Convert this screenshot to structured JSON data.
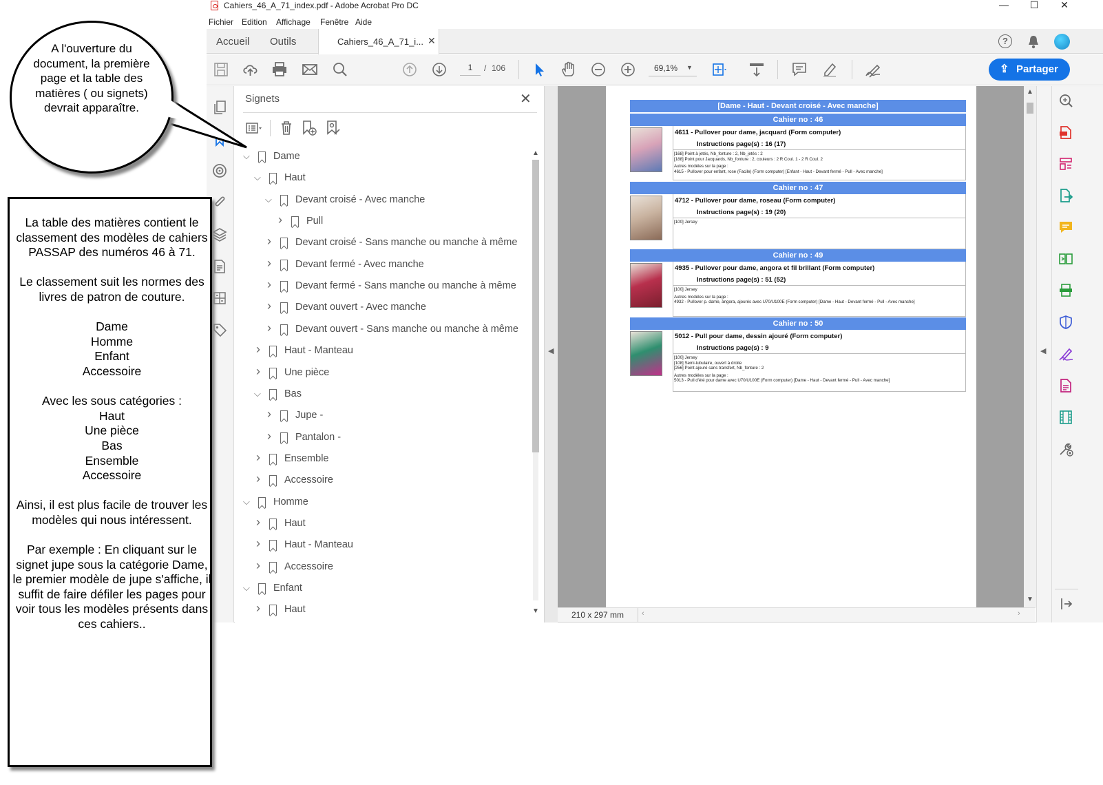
{
  "window": {
    "title": "Cahiers_46_A_71_index.pdf - Adobe Acrobat Pro DC",
    "controls": {
      "minimize": "—",
      "maximize": "☐",
      "close": "✕"
    }
  },
  "menu": [
    "Fichier",
    "Edition",
    "Affichage",
    "Fenêtre",
    "Aide"
  ],
  "tabs": {
    "home": "Accueil",
    "tools": "Outils",
    "document": "Cahiers_46_A_71_i...",
    "close": "✕"
  },
  "toolbar": {
    "page_current": "1",
    "page_sep": "/",
    "page_total": "106",
    "zoom": "69,1%",
    "share_label": "Partager"
  },
  "bookmarks": {
    "title": "Signets",
    "close": "✕",
    "items": [
      {
        "label": "Dame",
        "expanded": true,
        "level": 0
      },
      {
        "label": "Haut",
        "expanded": true,
        "level": 1
      },
      {
        "label": "Devant croisé - Avec manche",
        "expanded": true,
        "level": 2
      },
      {
        "label": "Pull",
        "expanded": false,
        "level": 3
      },
      {
        "label": "Devant croisé - Sans manche ou manche à même",
        "expanded": false,
        "level": 2
      },
      {
        "label": "Devant fermé - Avec manche",
        "expanded": false,
        "level": 2
      },
      {
        "label": "Devant fermé - Sans manche ou manche à même",
        "expanded": false,
        "level": 2
      },
      {
        "label": "Devant ouvert - Avec manche",
        "expanded": false,
        "level": 2
      },
      {
        "label": "Devant ouvert - Sans manche ou manche à même",
        "expanded": false,
        "level": 2
      },
      {
        "label": "Haut - Manteau",
        "expanded": false,
        "level": 1
      },
      {
        "label": "Une pièce",
        "expanded": false,
        "level": 1
      },
      {
        "label": "Bas",
        "expanded": true,
        "level": 1
      },
      {
        "label": "Jupe -",
        "expanded": false,
        "level": 2
      },
      {
        "label": "Pantalon -",
        "expanded": false,
        "level": 2
      },
      {
        "label": "Ensemble",
        "expanded": false,
        "level": 1
      },
      {
        "label": "Accessoire",
        "expanded": false,
        "level": 1
      },
      {
        "label": "Homme",
        "expanded": true,
        "level": 0
      },
      {
        "label": "Haut",
        "expanded": false,
        "level": 1
      },
      {
        "label": "Haut - Manteau",
        "expanded": false,
        "level": 1
      },
      {
        "label": "Accessoire",
        "expanded": false,
        "level": 1
      },
      {
        "label": "Enfant",
        "expanded": true,
        "level": 0
      },
      {
        "label": "Haut",
        "expanded": false,
        "level": 1
      }
    ]
  },
  "document": {
    "page_size": "210 x 297 mm",
    "header": "[Dame - Haut - Devant croisé - Avec manche]",
    "entries": [
      {
        "cahier": "Cahier no : 46",
        "model": "4611 - Pullover pour dame, jacquard   (Form computer)",
        "instructions": "Instructions page(s) : 16 (17)",
        "details": [
          "[168] Point à jetés, Nb_fonture : 2, Nb_jetés : 2",
          "[188] Point pour Jacquards, Nb_fonture : 2, couleurs : 2 R Coul. 1 -  2 R Coul. 2"
        ],
        "others": [
          "Autres modèles sur la page :",
          "4615 - Pullover pour enfant, rose (Facile)   (Form computer)  [Enfant - Haut - Devant fermé - Pull - Avec manche]"
        ]
      },
      {
        "cahier": "Cahier no : 47",
        "model": "4712 - Pullover pour dame, roseau   (Form computer)",
        "instructions": "Instructions page(s) : 19 (20)",
        "details": [
          "[100] Jersey"
        ],
        "others": []
      },
      {
        "cahier": "Cahier no : 49",
        "model": "4935 - Pullover pour dame, angora et fil brillant   (Form computer)",
        "instructions": "Instructions page(s) : 51 (52)",
        "details": [
          "[100] Jersey"
        ],
        "others": [
          "Autres modèles sur la page :",
          "4932 - Pullover p. dame, angora, ajourés avec U70/U100E   (Form computer)  [Dame - Haut - Devant fermé - Pull - Avec manche]"
        ]
      },
      {
        "cahier": "Cahier no : 50",
        "model": "5012 - Pull pour dame, dessin ajouré   (Form computer)",
        "instructions": "Instructions page(s) : 9",
        "details": [
          "[100] Jersey",
          "[108] Semi-tubulaire, ouvert à droite",
          "[256] Point ajouré sans transfert, Nb_fonture : 2"
        ],
        "others": [
          "Autres modèles sur la page :",
          "5013 - Pull d'été pour dame avec U70/U100E   (Form computer)  [Dame - Haut - Devant fermé - Pull - Avec manche]"
        ]
      }
    ]
  },
  "annotations": {
    "bubble": "A l'ouverture du document, la première page et la table des matières ( ou signets) devrait apparaître.",
    "note": "La table des matières contient le classement des modèles de cahiers PASSAP des numéros 46 à 71.\n\nLe classement suit les normes des livres de patron de couture.\n\nDame\nHomme\nEnfant\nAccessoire\n\nAvec les sous catégories :\nHaut\nUne pièce\nBas\nEnsemble\nAccessoire\n\nAinsi, il est plus facile de trouver les modèles qui nous intéressent.\n\nPar exemple : En cliquant sur le signet jupe sous la catégorie Dame, le premier modèle de jupe s'affiche, il suffit de faire défiler les pages pour voir tous les modèles présents dans ces cahiers.."
  },
  "colors": {
    "accent": "#1473e6",
    "banner": "#5b8ee6"
  }
}
